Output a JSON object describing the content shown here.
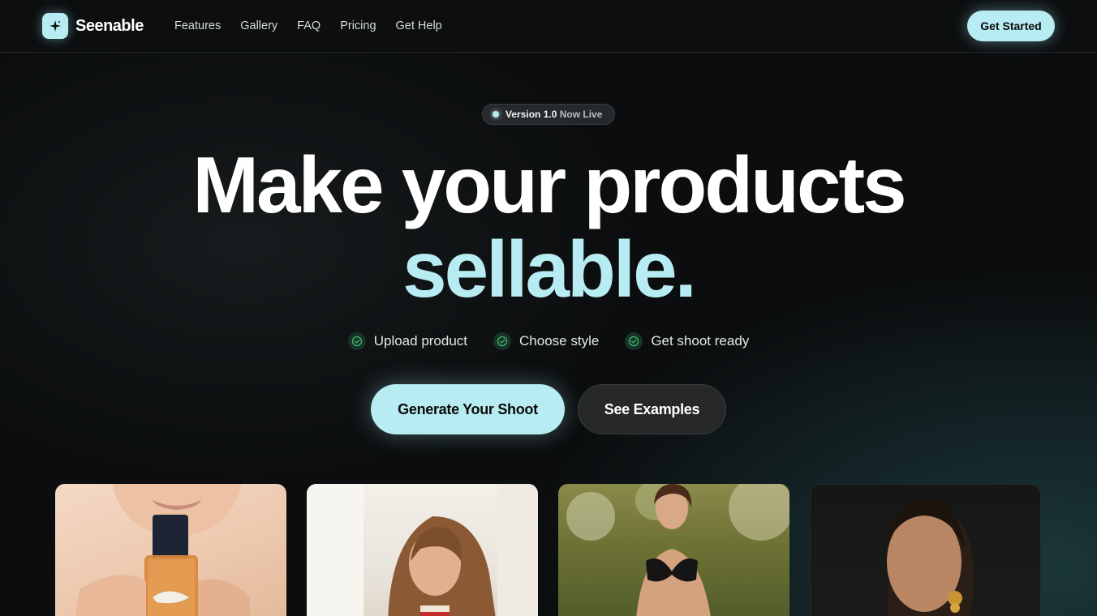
{
  "brand": {
    "name": "Seenable",
    "logo_icon": "sparkle-icon"
  },
  "nav": {
    "links": [
      "Features",
      "Gallery",
      "FAQ",
      "Pricing",
      "Get Help"
    ],
    "cta": "Get Started"
  },
  "badge": {
    "version": "Version 1.0",
    "status": "Now Live"
  },
  "hero": {
    "line1": "Make your products",
    "line2": "sellable."
  },
  "steps": [
    "Upload product",
    "Choose style",
    "Get shoot ready"
  ],
  "actions": {
    "primary": "Generate Your Shoot",
    "secondary": "See Examples"
  },
  "colors": {
    "accent": "#b7ecf2",
    "background": "#0b0d0e",
    "check": "#3fb871"
  }
}
